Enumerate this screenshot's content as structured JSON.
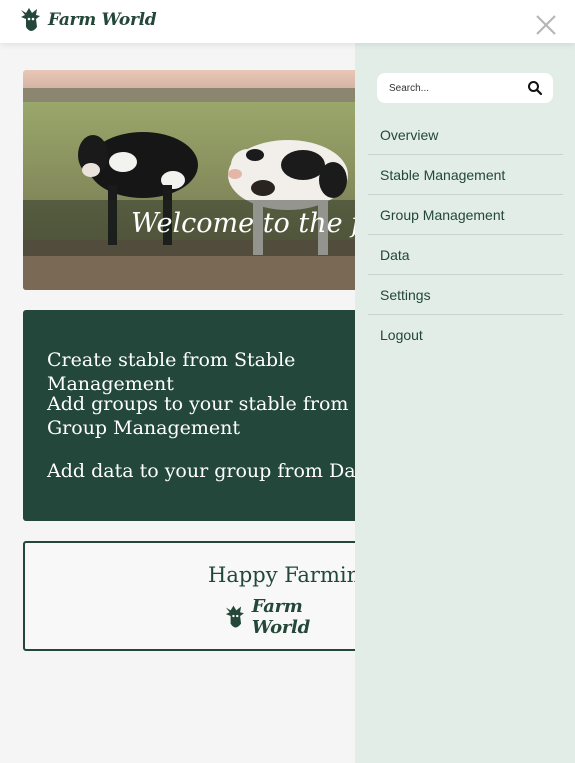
{
  "header": {
    "brand": "Farm World",
    "logo_icon": "cow-head-icon",
    "close_icon": "close-icon"
  },
  "hero": {
    "title": "Welcome to the farm"
  },
  "info": {
    "line1": "Create stable from Stable Management",
    "line2": "Add groups to your stable from Group Management",
    "line3": "Add data to your group from Data"
  },
  "footer_card": {
    "greeting": "Happy Farming!",
    "brand": "Farm World"
  },
  "drawer": {
    "search_placeholder": "Search...",
    "search_icon": "search-icon",
    "items": [
      {
        "label": "Overview"
      },
      {
        "label": "Stable Management"
      },
      {
        "label": "Group Management"
      },
      {
        "label": "Data"
      },
      {
        "label": "Settings"
      },
      {
        "label": "Logout"
      }
    ]
  },
  "colors": {
    "brand_green": "#23473a",
    "drawer_bg": "#e1ede6",
    "page_bg": "#f4f5f4"
  }
}
